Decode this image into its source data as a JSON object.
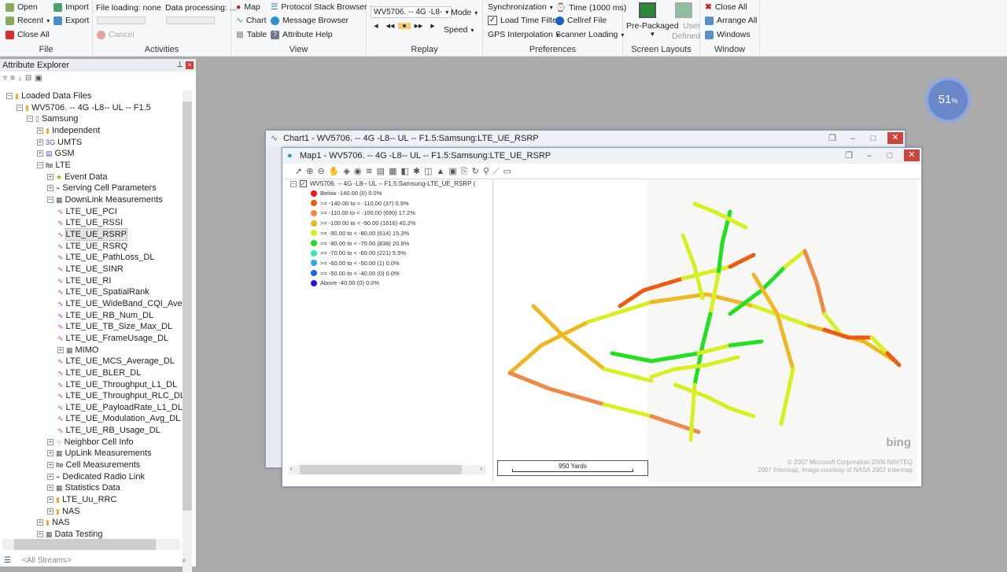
{
  "ribbon": {
    "file": {
      "label": "File",
      "open": "Open",
      "recent": "Recent",
      "close_all": "Close All",
      "import": "Import",
      "export": "Export"
    },
    "activities": {
      "label": "Activities",
      "file_loading": "File loading: none",
      "data_processing": "Data processing: ...",
      "cancel": "Cancel"
    },
    "view": {
      "label": "View",
      "map": "Map",
      "chart": "Chart",
      "table": "Table",
      "protocol_stack": "Protocol Stack Browser",
      "message_browser": "Message Browser",
      "attribute_help": "Attribute Help"
    },
    "replay": {
      "label": "Replay",
      "file_select": "WV5706. -- 4G -L8-",
      "mode": "Mode",
      "speed": "Speed",
      "buttons": [
        "◀",
        "◀◀",
        "■",
        "▶▶",
        "▶"
      ]
    },
    "preferences": {
      "label": "Preferences",
      "synchronization": "Synchronization",
      "time": "Time (1000 ms)",
      "load_time_filter": "Load Time Filter",
      "load_time_filter_checked": true,
      "cellref": "Cellref File",
      "gps_interp": "GPS Interpolation",
      "scanner_loading": "Scanner Loading"
    },
    "screen_layouts": {
      "label": "Screen Layouts",
      "pre_packaged": "Pre-Packaged",
      "user_defined_1": "User",
      "user_defined_2": "Defined"
    },
    "window": {
      "label": "Window",
      "close_all": "Close All",
      "arrange_all": "Arrange All",
      "windows": "Windows"
    }
  },
  "explorer": {
    "title": "Attribute Explorer",
    "search_placeholder": "<All Streams>",
    "tree": [
      {
        "label": "Loaded Data Files",
        "level": 0,
        "exp": "-",
        "icon": "folder"
      },
      {
        "label": "WV5706. -- 4G -L8-- UL -- F1.5",
        "level": 1,
        "exp": "-",
        "icon": "folder"
      },
      {
        "label": "Samsung",
        "level": 2,
        "exp": "-",
        "icon": "doc"
      },
      {
        "label": "Independent",
        "level": 3,
        "exp": "+",
        "icon": "folder"
      },
      {
        "label": "UMTS",
        "level": 3,
        "exp": "+",
        "icon": "3g"
      },
      {
        "label": "GSM",
        "level": 3,
        "exp": "+",
        "icon": "gsm"
      },
      {
        "label": "LTE",
        "level": 3,
        "exp": "-",
        "icon": "lte"
      },
      {
        "label": "Event Data",
        "level": 4,
        "exp": "+",
        "icon": "star"
      },
      {
        "label": "Serving Cell Parameters",
        "level": 4,
        "exp": "+",
        "icon": "sig"
      },
      {
        "label": "DownLink Measurements",
        "level": 4,
        "exp": "-",
        "icon": "meas"
      },
      {
        "label": "LTE_UE_PCI",
        "level": 5,
        "icon": "attr"
      },
      {
        "label": "LTE_UE_RSSI",
        "level": 5,
        "icon": "attr"
      },
      {
        "label": "LTE_UE_RSRP",
        "level": 5,
        "icon": "attr",
        "selected": true
      },
      {
        "label": "LTE_UE_RSRQ",
        "level": 5,
        "icon": "attr"
      },
      {
        "label": "LTE_UE_PathLoss_DL",
        "level": 5,
        "icon": "attr"
      },
      {
        "label": "LTE_UE_SINR",
        "level": 5,
        "icon": "attr"
      },
      {
        "label": "LTE_UE_RI",
        "level": 5,
        "icon": "attr"
      },
      {
        "label": "LTE_UE_SpatialRank",
        "level": 5,
        "icon": "attr"
      },
      {
        "label": "LTE_UE_WideBand_CQI_Ave",
        "level": 5,
        "icon": "attr"
      },
      {
        "label": "LTE_UE_RB_Num_DL",
        "level": 5,
        "icon": "attr"
      },
      {
        "label": "LTE_UE_TB_Size_Max_DL",
        "level": 5,
        "icon": "attr"
      },
      {
        "label": "LTE_UE_FrameUsage_DL",
        "level": 5,
        "icon": "attr"
      },
      {
        "label": "MIMO",
        "level": 5,
        "exp": "+",
        "icon": "meas"
      },
      {
        "label": "LTE_UE_MCS_Average_DL",
        "level": 5,
        "icon": "attr"
      },
      {
        "label": "LTE_UE_BLER_DL",
        "level": 5,
        "icon": "attr"
      },
      {
        "label": "LTE_UE_Throughput_L1_DL",
        "level": 5,
        "icon": "attr"
      },
      {
        "label": "LTE_UE_Throughput_RLC_DL",
        "level": 5,
        "icon": "attr"
      },
      {
        "label": "LTE_UE_PayloadRate_L1_DL",
        "level": 5,
        "icon": "attr"
      },
      {
        "label": "LTE_UE_Modulation_Avg_DL",
        "level": 5,
        "icon": "attr"
      },
      {
        "label": "LTE_UE_RB_Usage_DL",
        "level": 5,
        "icon": "attr"
      },
      {
        "label": "Neighbor Cell Info",
        "level": 4,
        "exp": "+",
        "icon": "dots"
      },
      {
        "label": "UpLink Measurements",
        "level": 4,
        "exp": "+",
        "icon": "meas"
      },
      {
        "label": "Cell Measurements",
        "level": 4,
        "exp": "+",
        "icon": "lte"
      },
      {
        "label": "Dedicated Radio Link",
        "level": 4,
        "exp": "+",
        "icon": "sig"
      },
      {
        "label": "Statistics Data",
        "level": 4,
        "exp": "+",
        "icon": "meas"
      },
      {
        "label": "LTE_Uu_RRC",
        "level": 4,
        "exp": "+",
        "icon": "folder"
      },
      {
        "label": "NAS",
        "level": 4,
        "exp": "+",
        "icon": "folder"
      },
      {
        "label": "NAS",
        "level": 3,
        "exp": "+",
        "icon": "folder"
      },
      {
        "label": "Data Testing",
        "level": 3,
        "exp": "+",
        "icon": "meas"
      }
    ]
  },
  "badge": {
    "value": "51",
    "unit": "%"
  },
  "chart_window": {
    "title": "Chart1 - WV5706. -- 4G -L8-- UL -- F1.5:Samsung:LTE_UE_RSRP"
  },
  "map_window": {
    "title": "Map1 - WV5706. -- 4G -L8-- UL -- F1.5:Samsung:LTE_UE_RSRP",
    "layer": "WV5706. -- 4G -L8-- UL -- F1.5:Samsung-LTE_UE_RSRP (",
    "legend": [
      {
        "label": "Below -140.00 (0) 0.0%",
        "color": "#ff1010"
      },
      {
        "label": ">= -140.00 to < -110.00 (37) 0.9%",
        "color": "#f05a10"
      },
      {
        "label": ">= -110.00 to < -100.00 (690) 17.2%",
        "color": "#f08848"
      },
      {
        "label": ">= -100.00 to < -90.00 (1616) 40.2%",
        "color": "#f0b820"
      },
      {
        "label": ">= -90.00 to < -80.00 (614) 15.3%",
        "color": "#d8f020"
      },
      {
        "label": ">= -80.00 to < -70.00 (838) 20.9%",
        "color": "#20e020"
      },
      {
        "label": ">= -70.00 to < -60.00 (221) 5.5%",
        "color": "#30e8b0"
      },
      {
        "label": ">= -60.00 to < -50.00 (1) 0.0%",
        "color": "#30a8d8"
      },
      {
        "label": ">= -50.00 to < -40.00 (0) 0.0%",
        "color": "#1860f0"
      },
      {
        "label": "Above -40.00 (0) 0.0%",
        "color": "#2010e0"
      }
    ],
    "scale": "950 Yards",
    "brand": "bing",
    "copyright1": "© 2007 Microsoft Corporation   2006 NAVTEQ",
    "copyright2": "2007 Intermap, Image courtesy of NASA   2007 Intermap"
  }
}
